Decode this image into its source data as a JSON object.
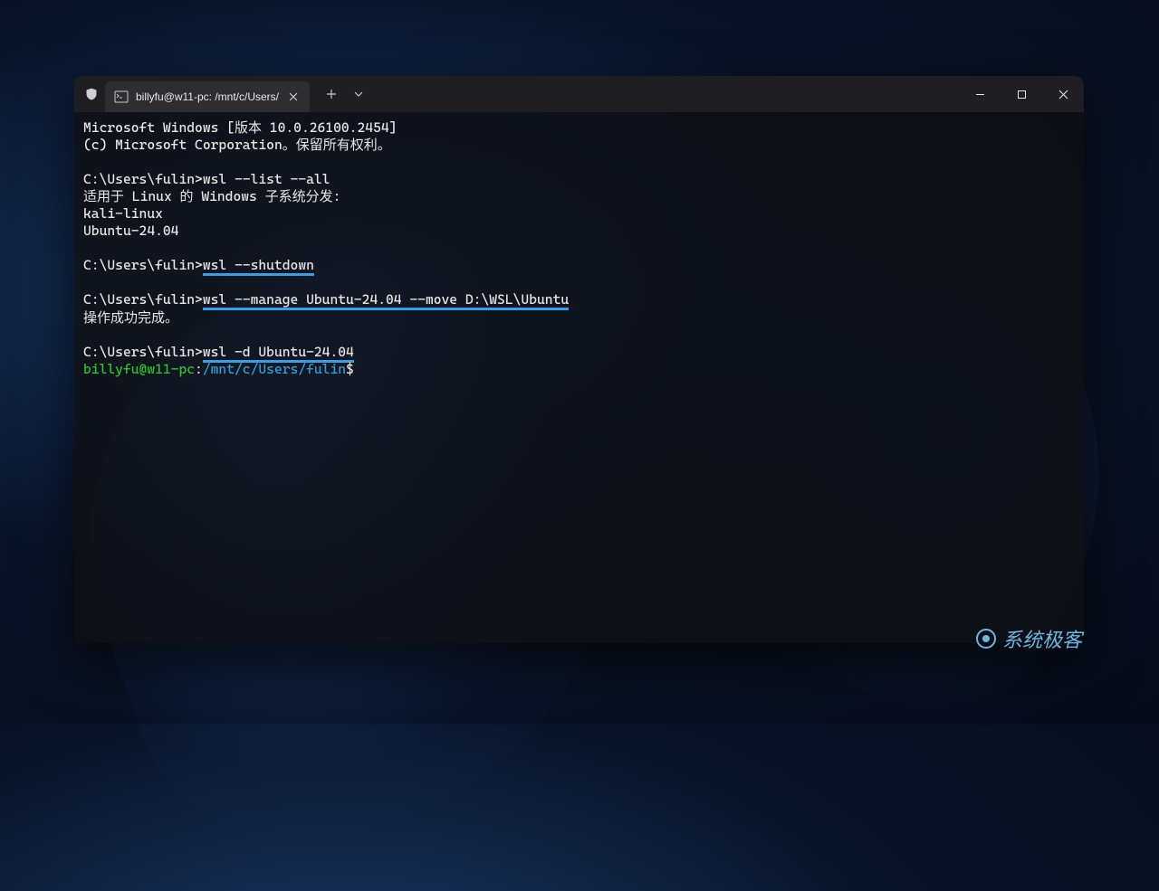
{
  "tab": {
    "title": "billyfu@w11-pc: /mnt/c/Users/"
  },
  "terminal": {
    "line1": "Microsoft Windows [版本 10.0.26100.2454]",
    "line2": "(c) Microsoft Corporation。保留所有权利。",
    "prompt1": "C:\\Users\\fulin>",
    "cmd1": "wsl --list --all",
    "out1a": "适用于 Linux 的 Windows 子系统分发:",
    "out1b": "kali-linux",
    "out1c": "Ubuntu-24.04",
    "prompt2": "C:\\Users\\fulin>",
    "cmd2": "wsl --shutdown",
    "prompt3": "C:\\Users\\fulin>",
    "cmd3": "wsl --manage Ubuntu-24.04 --move D:\\WSL\\Ubuntu",
    "out3": "操作成功完成。",
    "prompt4": "C:\\Users\\fulin>",
    "cmd4": "wsl -d Ubuntu-24.04",
    "linux_user": "billyfu@w11-pc",
    "linux_colon": ":",
    "linux_path": "/mnt/c/Users/fulin",
    "linux_dollar": "$"
  },
  "watermark": {
    "text": "系统极客"
  }
}
